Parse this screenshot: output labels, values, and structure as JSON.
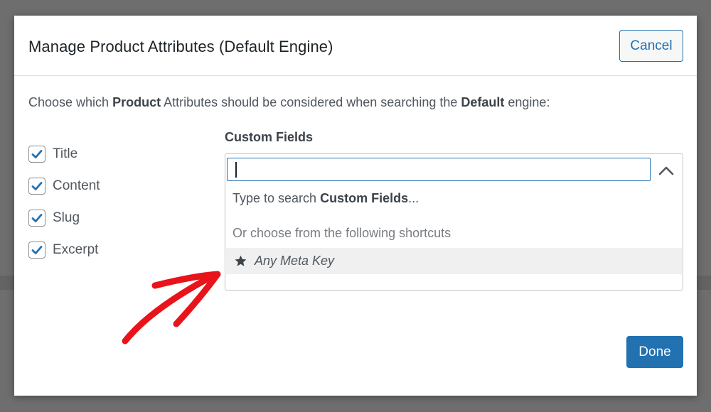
{
  "modal": {
    "title": "Manage Product Attributes (Default Engine)",
    "cancel_label": "Cancel",
    "done_label": "Done"
  },
  "intro": {
    "prefix": "Choose which ",
    "bold1": "Product",
    "middle": " Attributes should be considered when searching the ",
    "bold2": "Default",
    "suffix": " engine:"
  },
  "attributes": [
    {
      "label": "Title",
      "checked": true
    },
    {
      "label": "Content",
      "checked": true
    },
    {
      "label": "Slug",
      "checked": true
    },
    {
      "label": "Excerpt",
      "checked": true
    }
  ],
  "custom_fields": {
    "label": "Custom Fields",
    "input_value": "",
    "hint_prefix": "Type to search ",
    "hint_bold": "Custom Fields",
    "hint_suffix": "...",
    "shortcuts_heading": "Or choose from the following shortcuts",
    "options": [
      {
        "label": "Any Meta Key",
        "icon": "star-icon"
      }
    ]
  },
  "colors": {
    "accent": "#2271b1",
    "annotation_arrow": "#e8131b",
    "option_highlight": "#f0f0f1"
  }
}
